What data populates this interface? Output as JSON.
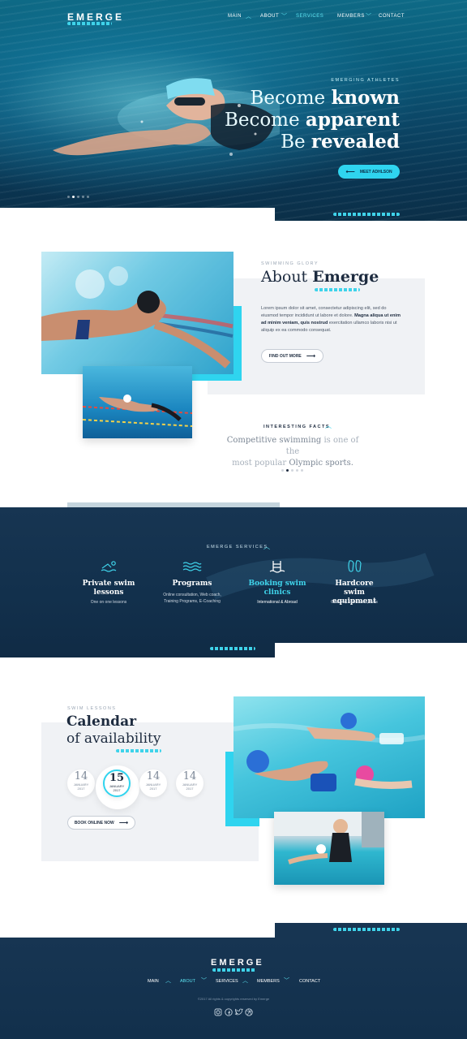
{
  "brand": "EMERGE",
  "nav": {
    "items": [
      "MAIN",
      "ABOUT",
      "SERVICES",
      "MEMBERS",
      "CONTACT"
    ]
  },
  "hero": {
    "tag": "EMERGING ATHLETES",
    "line1_light": "Become ",
    "line1_bold": "known",
    "line2_light": "Become ",
    "line2_bold": "apparent",
    "line3_light": "Be ",
    "line3_bold": "revealed",
    "button": "MEET ADHLSON",
    "slide_count": 5,
    "active_slide": 1
  },
  "about": {
    "tag": "SWIMMING GLORY",
    "title_light": "About ",
    "title_bold": "Emerge",
    "body_1": "Lorem ipsum dolor sit amet, consectetur adipiscing elit, sed do eiusmod tempor incididunt ut labore et dolore. ",
    "body_bold": "Magna aliqua ut enim ad minim veniam, quis nostrud",
    "body_2": " exercitation ullamco laboris nisi ut aliquip ex ea commodo consequat.",
    "button": "FIND OUT MORE"
  },
  "facts": {
    "tag": "INTERESTING FACTS",
    "line1_a": "Competitive swimming",
    "line1_b": " is one of the",
    "line2_a": "most popular ",
    "line2_b": "Olympic sports."
  },
  "services": {
    "tag": "EMERGE SERVICES",
    "items": [
      {
        "title1": "Private swim",
        "title2": "lessons",
        "desc1": "One on one lessons",
        "desc2": "",
        "icon": "swimmer-icon"
      },
      {
        "title1": "Programs",
        "title2": "",
        "desc1": "Online consultation, Web coach,",
        "desc2": "Training Programs, E-Coaching",
        "icon": "waves-icon"
      },
      {
        "title1": "Booking swim",
        "title2": "clinics",
        "desc1": "International & Abroad",
        "desc2": "",
        "icon": "pool-ladder-icon"
      },
      {
        "title1": "Hardcore swim",
        "title2": "equipment",
        "desc1": "Glasses, Swim suits, Hats",
        "desc2": "",
        "icon": "flippers-icon"
      }
    ]
  },
  "calendar": {
    "tag": "SWIM LESSONS",
    "title_bold": "Calendar",
    "title_light": "of availability",
    "days": [
      {
        "num": "14",
        "month": "JANUARY",
        "year": "2017"
      },
      {
        "num": "15",
        "month": "JANUARY",
        "year": "2017"
      },
      {
        "num": "14",
        "month": "JANUARY",
        "year": "2017"
      },
      {
        "num": "14",
        "month": "JANUARY",
        "year": "2017"
      }
    ],
    "button": "BOOK ONLINE NOW"
  },
  "footer": {
    "brand": "EMERGE",
    "nav": [
      "MAIN",
      "ABOUT",
      "SERVICES",
      "MEMBERS",
      "CONTACT"
    ],
    "copyright": "©2017 All rights & copyrights reserved by Emerge",
    "social": [
      "instagram-icon",
      "facebook-icon",
      "twitter-icon",
      "dribbble-icon"
    ]
  },
  "colors": {
    "accent": "#2fd4ef",
    "navy": "#173552",
    "text": "#1d2b3f"
  }
}
